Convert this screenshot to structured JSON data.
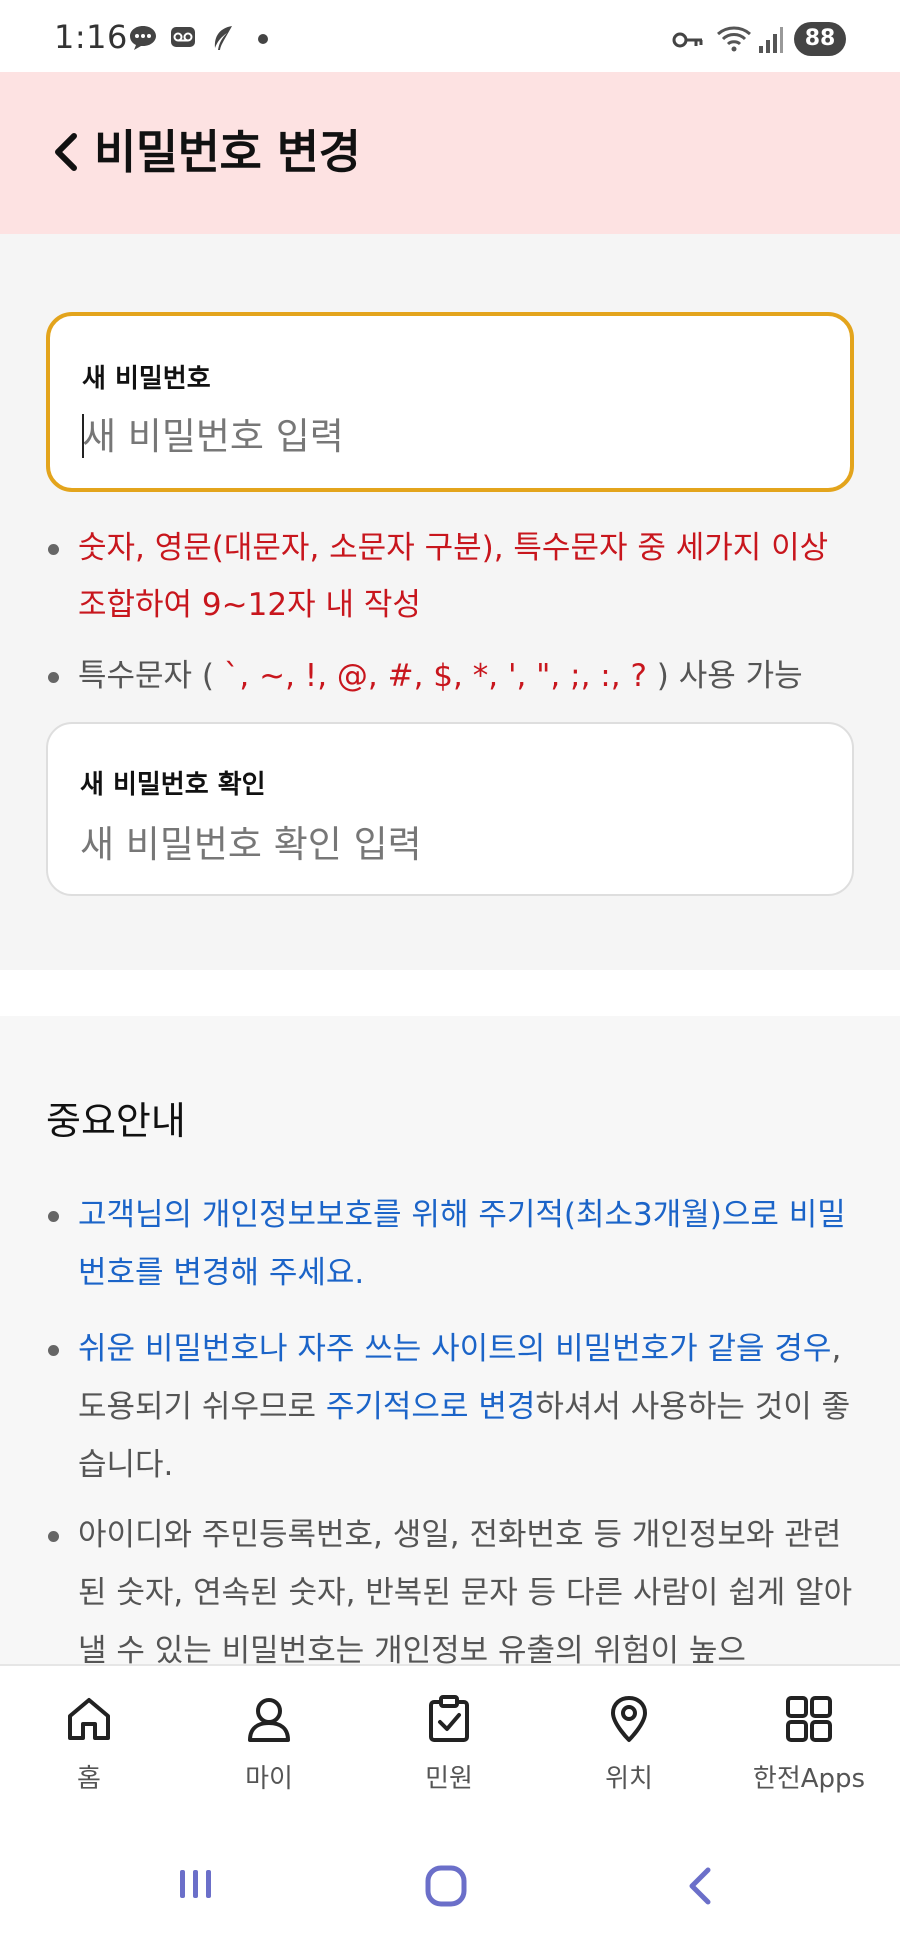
{
  "status_bar": {
    "time": "1:16",
    "battery": "88",
    "icons": [
      "chat-bubble-icon",
      "voicemail-icon",
      "leaf-icon",
      "dot-icon",
      "key-icon",
      "wifi-icon",
      "signal-icon"
    ]
  },
  "header": {
    "title": "비밀번호 변경",
    "background_color": "#fde2e2"
  },
  "form": {
    "new_password": {
      "label": "새 비밀번호",
      "placeholder": "새 비밀번호 입력",
      "value": "",
      "focused": true,
      "border_color": "#e3a41c"
    },
    "rules": {
      "combination": "숫자, 영문(대문자, 소문자 구분), 특수문자 중 세가지 이상 조합하여 9~12자 내 작성",
      "special_prefix": "특수문자 (",
      "special_chars": " `, ~, !, @, #, $, *, ', \", ;, :, ? ",
      "special_suffix": ") 사용 가능"
    },
    "confirm_password": {
      "label": "새 비밀번호 확인",
      "placeholder": "새 비밀번호 확인 입력",
      "value": ""
    }
  },
  "notes": {
    "title": "중요안내",
    "items": [
      {
        "text": "고객님의 개인정보보호를 위해 주기적(최소3개월)으로 비밀번호를 변경해 주세요."
      },
      {
        "part1": "쉬운 비밀번호나 자주 쓰는 사이트의 비밀번호가 같을 경우",
        "part2": ", 도용되기 쉬우므로 ",
        "part3": "주기적으로 변경",
        "part4": "하셔서 사용하는 것이 좋습니다."
      },
      {
        "text": "아이디와 주민등록번호, 생일, 전화번호 등 개인정보와 관련된 숫자, 연속된 숫자, 반복된 문자 등 다른 사람이 쉽게 알아 낼 수 있는 비밀번호는 개인정보 유출의 위험이 높으"
      }
    ]
  },
  "bottom_nav": {
    "items": [
      {
        "label": "홈",
        "icon": "home-icon"
      },
      {
        "label": "마이",
        "icon": "person-icon"
      },
      {
        "label": "민원",
        "icon": "clipboard-check-icon"
      },
      {
        "label": "위치",
        "icon": "location-pin-icon"
      },
      {
        "label": "한전Apps",
        "icon": "apps-grid-icon"
      }
    ]
  },
  "colors": {
    "warning_red": "#c8161d",
    "link_blue": "#1b64c8",
    "focus_border": "#e3a41c",
    "system_nav": "#6b6fc9"
  }
}
